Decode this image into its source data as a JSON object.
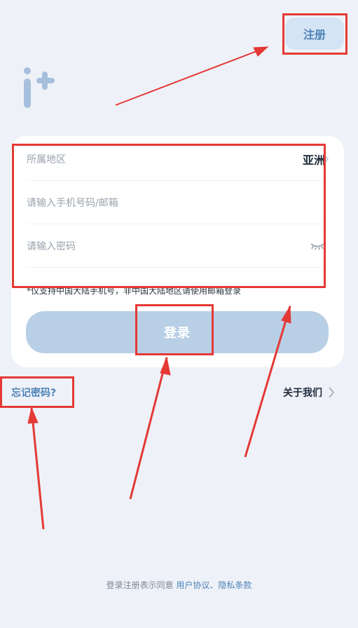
{
  "header": {
    "register_label": "注册"
  },
  "form": {
    "region_label": "所属地区",
    "region_value": "亚洲",
    "phone_placeholder": "请输入手机号码/邮箱",
    "password_placeholder": "请输入密码",
    "notice": "*仅支持中国大陆手机号，非中国大陆地区请使用邮箱登录",
    "login_label": "登录"
  },
  "links": {
    "forgot_password": "忘记密码?",
    "about_us": "关于我们"
  },
  "footer": {
    "prefix": "登录注册表示同意 ",
    "user_agreement": "用户协议",
    "separator": "、",
    "privacy": "隐私条款"
  },
  "colors": {
    "accent": "#4f82b7",
    "button_disabled": "#b8cfe6",
    "annotation_red": "#e53935",
    "background": "#eef2f8"
  },
  "icons": [
    "logo-icon",
    "chevron-right-icon",
    "eye-closed-icon"
  ]
}
